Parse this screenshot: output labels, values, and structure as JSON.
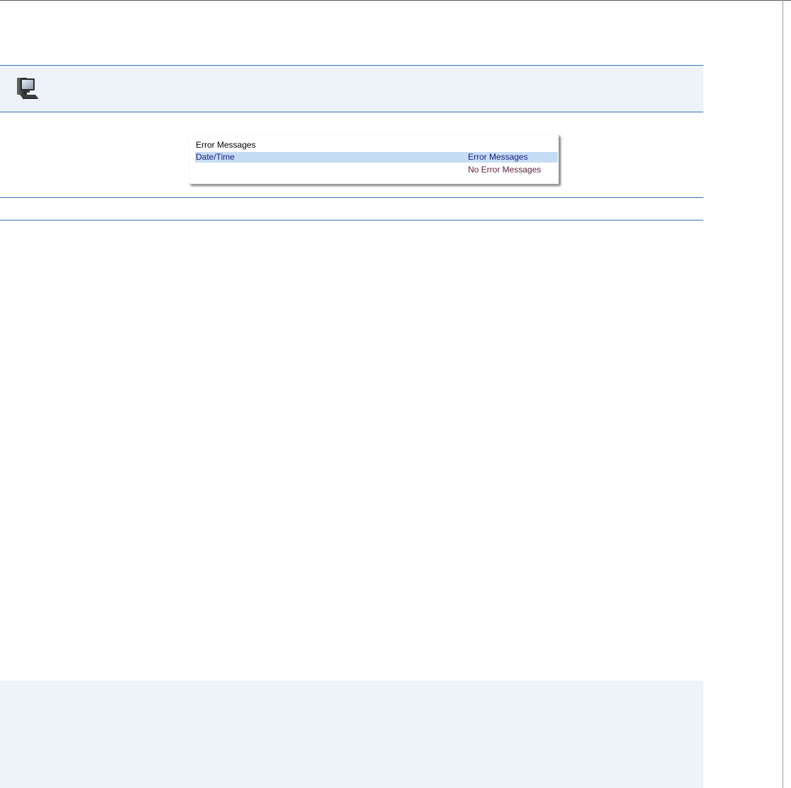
{
  "error_panel": {
    "title": "Error Messages",
    "columns": [
      "Date/Time",
      "Error Messages"
    ],
    "rows": [
      {
        "date_time": "",
        "message": "No Error Messages"
      }
    ]
  },
  "icons": {
    "header": "computer-icon"
  },
  "colors": {
    "rule_blue": "#2f72b8",
    "band_bg": "#eef3fa",
    "table_header_bg": "#c5dcf5",
    "header_text": "#1a1a7a",
    "message_text": "#5a1e3c"
  }
}
